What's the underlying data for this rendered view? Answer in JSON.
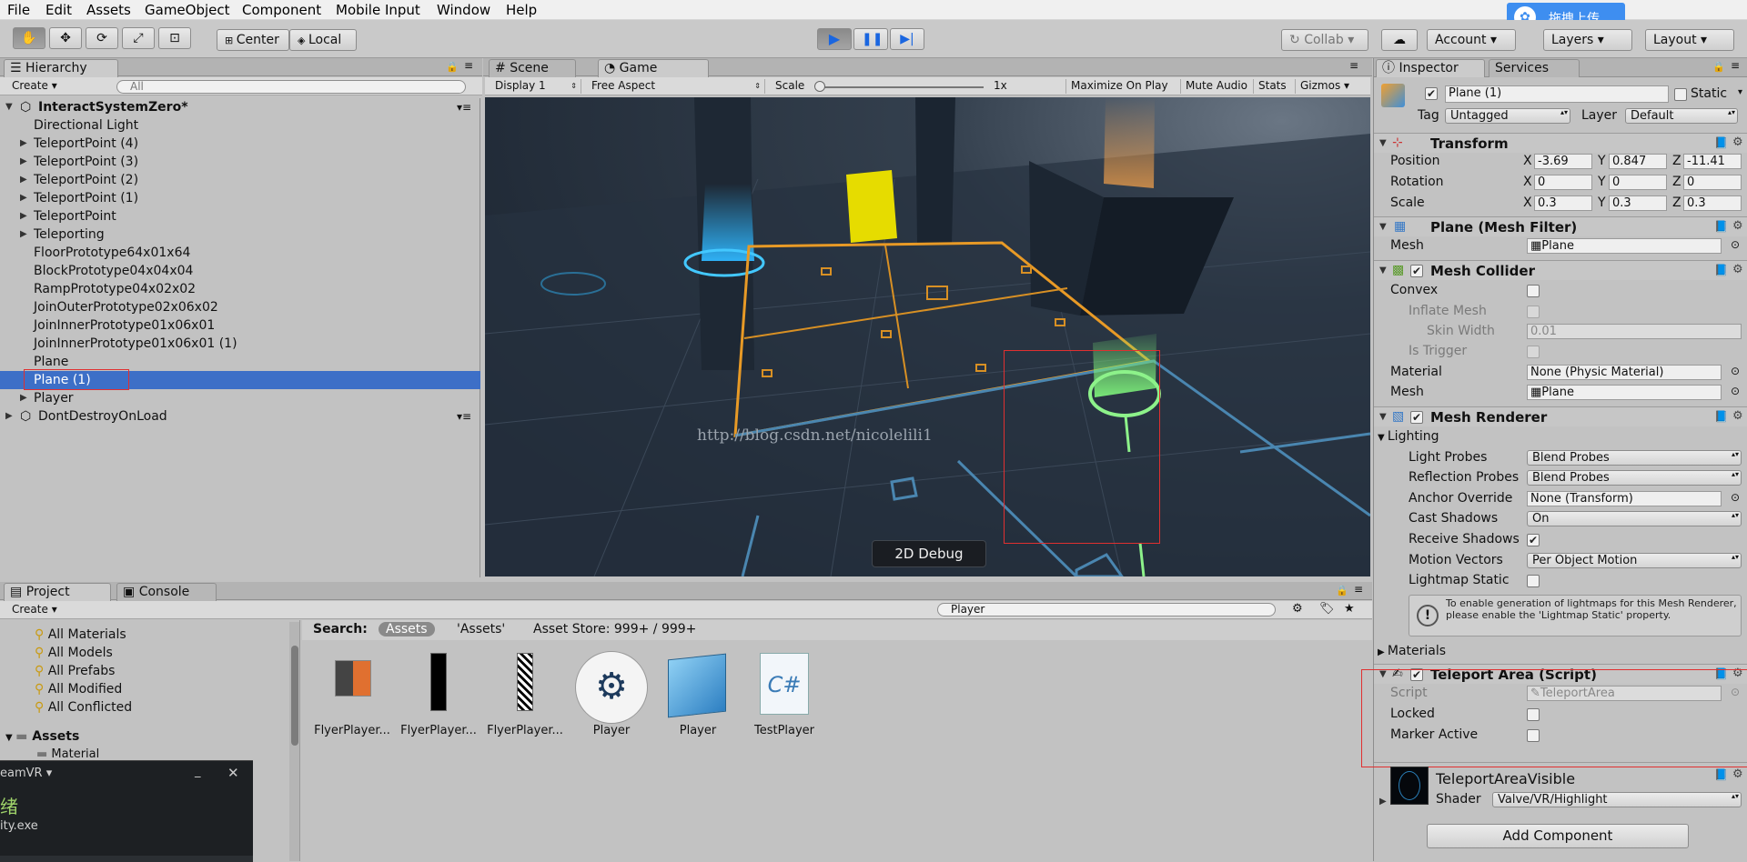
{
  "menu": [
    "File",
    "Edit",
    "Assets",
    "GameObject",
    "Component",
    "Mobile Input",
    "Window",
    "Help"
  ],
  "upload_button": "拖拽上传",
  "toolbar": {
    "center": "Center",
    "local": "Local",
    "collab": "Collab",
    "account": "Account",
    "layers": "Layers",
    "layout": "Layout"
  },
  "hierarchy": {
    "tab": "Hierarchy",
    "create": "Create",
    "search_placeholder": "All",
    "scene_name": "InteractSystemZero*",
    "items": [
      {
        "label": "Directional Light",
        "expandable": false
      },
      {
        "label": "TeleportPoint (4)",
        "expandable": true
      },
      {
        "label": "TeleportPoint (3)",
        "expandable": true
      },
      {
        "label": "TeleportPoint (2)",
        "expandable": true
      },
      {
        "label": "TeleportPoint (1)",
        "expandable": true
      },
      {
        "label": "TeleportPoint",
        "expandable": true
      },
      {
        "label": "Teleporting",
        "expandable": true
      },
      {
        "label": "FloorPrototype64x01x64",
        "expandable": false
      },
      {
        "label": "BlockPrototype04x04x04",
        "expandable": false
      },
      {
        "label": "RampPrototype04x02x02",
        "expandable": false
      },
      {
        "label": "JoinOuterPrototype02x06x02",
        "expandable": false
      },
      {
        "label": "JoinInnerPrototype01x06x01",
        "expandable": false
      },
      {
        "label": "JoinInnerPrototype01x06x01 (1)",
        "expandable": false
      },
      {
        "label": "Plane",
        "expandable": false
      },
      {
        "label": "Plane (1)",
        "expandable": false,
        "selected": true
      },
      {
        "label": "Player",
        "expandable": true
      }
    ],
    "dont_destroy": "DontDestroyOnLoad"
  },
  "game": {
    "tab_scene": "Scene",
    "tab_game": "Game",
    "display": "Display 1",
    "aspect": "Free Aspect",
    "scale_label": "Scale",
    "scale_value": "1x",
    "maximize": "Maximize On Play",
    "mute": "Mute Audio",
    "stats": "Stats",
    "gizmos": "Gizmos",
    "watermark": "http://blog.csdn.net/nicolelili1",
    "debug_button": "2D Debug"
  },
  "inspector": {
    "tab": "Inspector",
    "tab_services": "Services",
    "object_name": "Plane (1)",
    "static_label": "Static",
    "tag_label": "Tag",
    "tag_value": "Untagged",
    "layer_label": "Layer",
    "layer_value": "Default",
    "transform": {
      "title": "Transform",
      "position_label": "Position",
      "rotation_label": "Rotation",
      "scale_label": "Scale",
      "position": [
        "-3.69",
        "0.847",
        "-11.41"
      ],
      "rotation": [
        "0",
        "0",
        "0"
      ],
      "scale": [
        "0.3",
        "0.3",
        "0.3"
      ]
    },
    "mesh_filter": {
      "title": "Plane (Mesh Filter)",
      "mesh_label": "Mesh",
      "mesh_value": "Plane"
    },
    "mesh_collider": {
      "title": "Mesh Collider",
      "convex": "Convex",
      "inflate": "Inflate Mesh",
      "skin_width": "Skin Width",
      "skin_value": "0.01",
      "is_trigger": "Is Trigger",
      "material": "Material",
      "material_value": "None (Physic Material)",
      "mesh": "Mesh",
      "mesh_value": "Plane"
    },
    "mesh_renderer": {
      "title": "Mesh Renderer",
      "lighting": "Lighting",
      "light_probes": "Light Probes",
      "light_probes_value": "Blend Probes",
      "reflection_probes": "Reflection Probes",
      "reflection_probes_value": "Blend Probes",
      "anchor_override": "Anchor Override",
      "anchor_override_value": "None (Transform)",
      "cast_shadows": "Cast Shadows",
      "cast_shadows_value": "On",
      "receive_shadows": "Receive Shadows",
      "motion_vectors": "Motion Vectors",
      "motion_vectors_value": "Per Object Motion",
      "lightmap_static": "Lightmap Static",
      "info": "To enable generation of lightmaps for this Mesh Renderer, please enable the 'Lightmap Static' property."
    },
    "materials": "Materials",
    "teleport_area": {
      "title": "Teleport Area (Script)",
      "script": "Script",
      "script_value": "TeleportArea",
      "locked": "Locked",
      "marker_active": "Marker Active"
    },
    "material_asset": {
      "title": "TeleportAreaVisible",
      "shader_label": "Shader",
      "shader_value": "Valve/VR/Highlight"
    },
    "add_component": "Add Component"
  },
  "project": {
    "tab": "Project",
    "tab_console": "Console",
    "create": "Create",
    "search_value": "Player",
    "favorites": [
      "All Materials",
      "All Models",
      "All Prefabs",
      "All Modified",
      "All Conflicted"
    ],
    "assets_root": "Assets",
    "assets_child": "Material",
    "search_label": "Search:",
    "scope_assets": "Assets",
    "scope_quoted": "'Assets'",
    "asset_store": "Asset Store: 999+ / 999+",
    "items": [
      "FlyerPlayer...",
      "FlyerPlayer...",
      "FlyerPlayer...",
      "Player",
      "Player",
      "TestPlayer"
    ]
  },
  "steamvr": {
    "title": "eamVR",
    "status": "绪",
    "exe": "ity.exe"
  }
}
